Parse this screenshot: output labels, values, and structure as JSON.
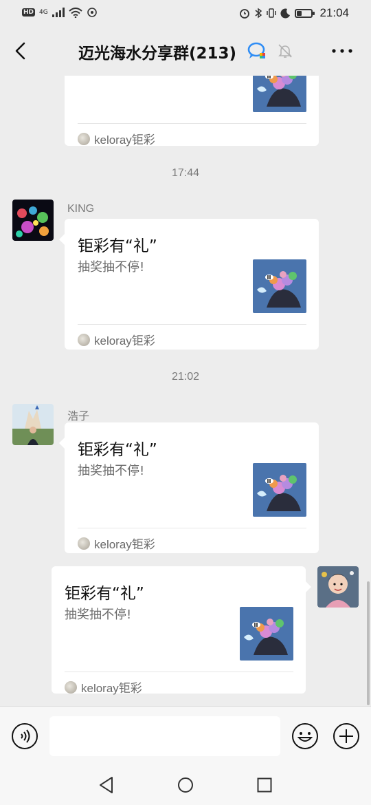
{
  "status_bar": {
    "left_badge": "HD",
    "network": "4G",
    "time": "21:04",
    "battery_level": 0.3
  },
  "header": {
    "title": "迈光海水分享群(213)",
    "icons": [
      "back-arrow-icon",
      "wecom-logo-icon",
      "mute-bell-icon",
      "more-dots-icon"
    ]
  },
  "messages": {
    "timestamp_1": "17:44",
    "timestamp_2": "21:02",
    "card0": {
      "source": "keloray钜彩"
    },
    "msg1": {
      "sender": "KING",
      "title": "钜彩有“礼”",
      "desc": "抽奖抽不停!",
      "source": "keloray钜彩"
    },
    "msg2": {
      "sender": "浩子",
      "title": "钜彩有“礼”",
      "desc": "抽奖抽不停!",
      "source": "keloray钜彩"
    },
    "msg3": {
      "title": "钜彩有“礼”",
      "desc": "抽奖抽不停!",
      "source": "keloray钜彩"
    }
  },
  "input_bar": {
    "text_value": "",
    "icons": [
      "voice-icon",
      "emoji-icon",
      "plus-icon"
    ]
  },
  "nav_bar": {
    "icons": [
      "nav-back-icon",
      "nav-home-icon",
      "nav-recents-icon"
    ]
  },
  "colors": {
    "background": "#ededed",
    "card": "#ffffff",
    "muted_text": "#7a7a7a",
    "thumb_blue": "#4a74ad"
  }
}
